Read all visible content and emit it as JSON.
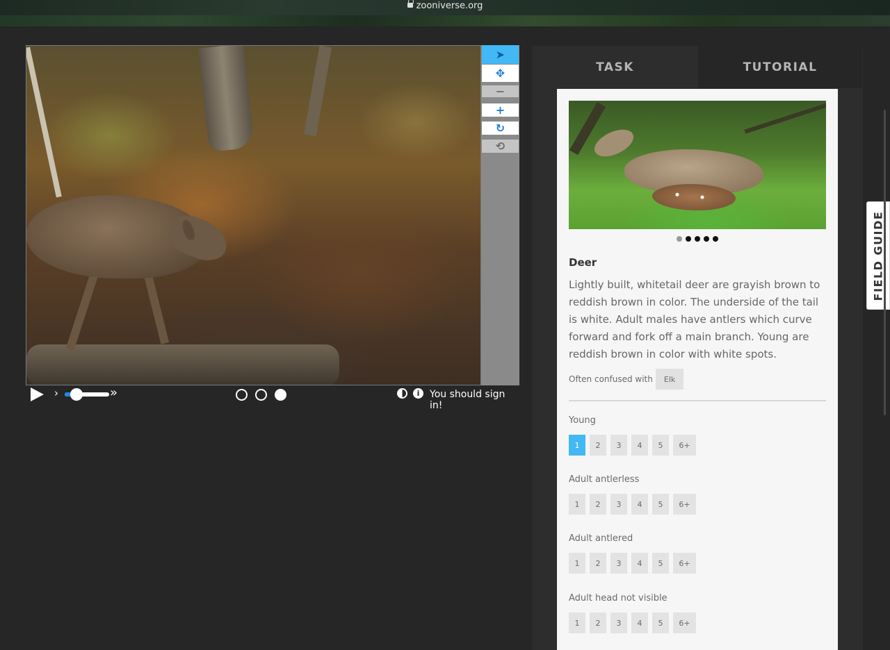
{
  "browser": {
    "url": "zooniverse.org"
  },
  "viewer": {
    "tools": [
      {
        "name": "pointer",
        "glyph": "➤"
      },
      {
        "name": "pan",
        "glyph": "✥"
      },
      {
        "name": "zoom-out",
        "glyph": "−"
      },
      {
        "name": "zoom-in",
        "glyph": "+"
      },
      {
        "name": "rotate",
        "glyph": "↻"
      },
      {
        "name": "reset",
        "glyph": "⟲"
      }
    ],
    "controls": {
      "chevron_single": "›",
      "chevron_double": "»",
      "frames": 3,
      "current_frame": 3,
      "signin_text": "You should sign in!",
      "info_glyph": "i"
    }
  },
  "tabs": {
    "task": "TASK",
    "tutorial": "TUTORIAL"
  },
  "field_guide": {
    "side_tab_label": "FIELD GUIDE",
    "carousel": {
      "count": 5,
      "current": 1
    },
    "title": "Deer",
    "description": "Lightly built, whitetail deer are grayish brown to reddish brown in color. The underside of the tail is white. Adult males have antlers which curve forward and fork off a main branch. Young are reddish brown in color with white spots.",
    "confused_label": "Often confused with",
    "confused_with": "Elk",
    "questions": [
      {
        "label": "Young",
        "options": [
          "1",
          "2",
          "3",
          "4",
          "5",
          "6+"
        ],
        "selected": "1"
      },
      {
        "label": "Adult antlerless",
        "options": [
          "1",
          "2",
          "3",
          "4",
          "5",
          "6+"
        ],
        "selected": null
      },
      {
        "label": "Adult antlered",
        "options": [
          "1",
          "2",
          "3",
          "4",
          "5",
          "6+"
        ],
        "selected": null
      },
      {
        "label": "Adult head not visible",
        "options": [
          "1",
          "2",
          "3",
          "4",
          "5",
          "6+"
        ],
        "selected": null
      }
    ]
  },
  "colors": {
    "accent": "#42b8f5",
    "icon_blue": "#1f7fd7",
    "panel_bg": "#2d2d2d",
    "page_bg": "#262626"
  }
}
